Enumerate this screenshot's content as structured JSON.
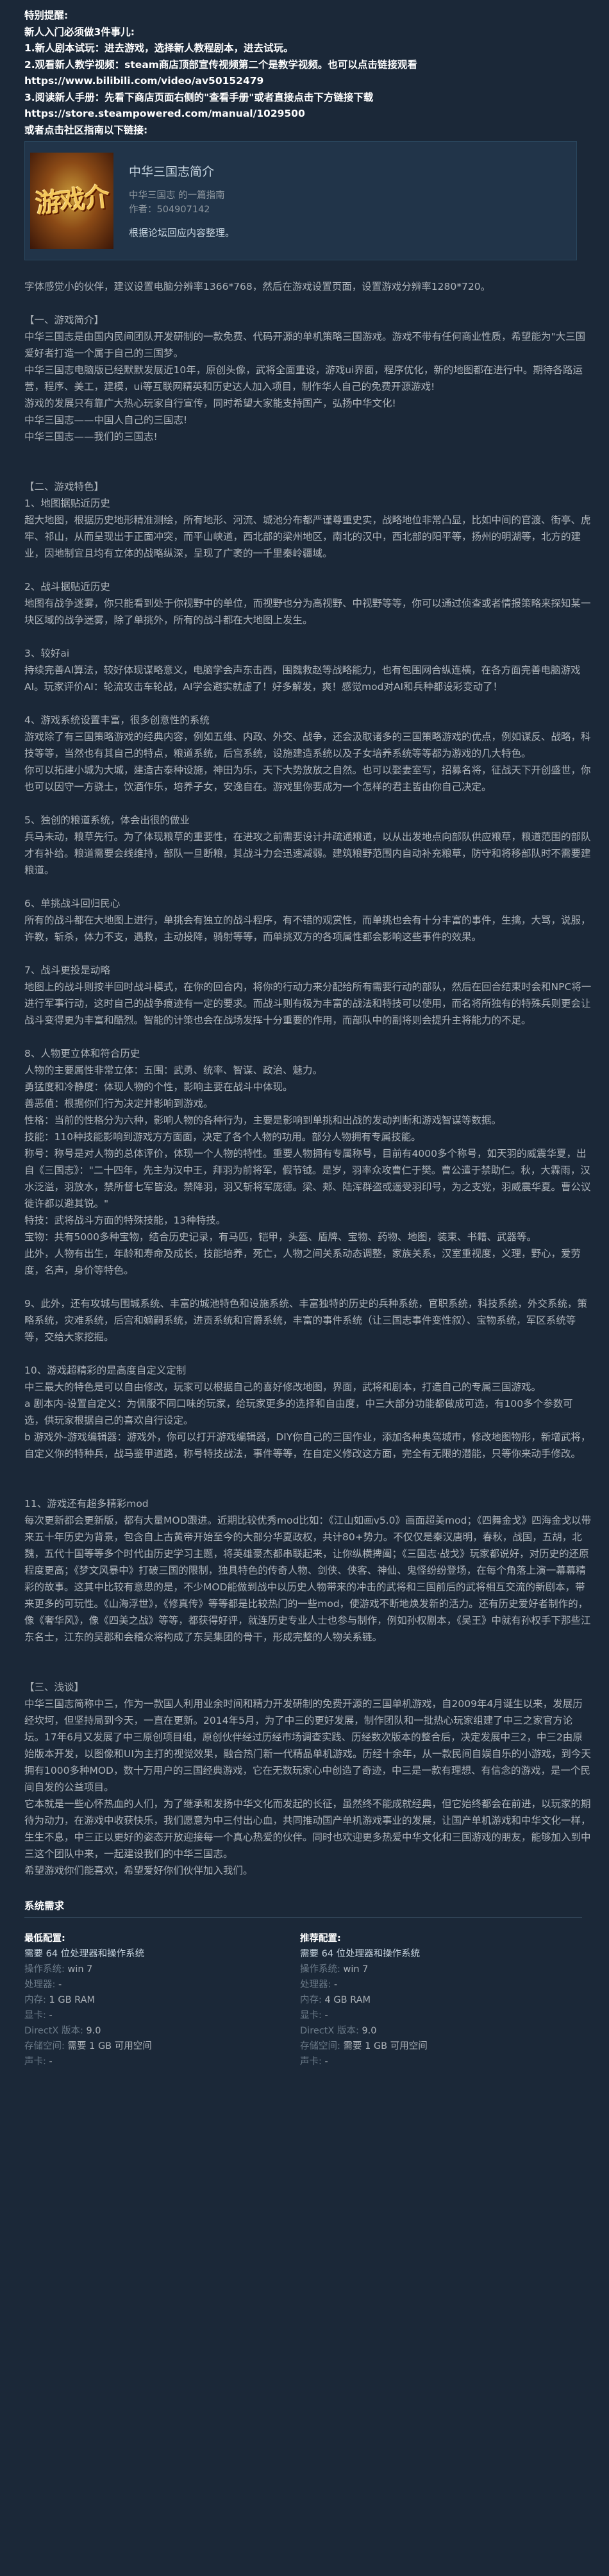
{
  "notice": {
    "lines": [
      "特别提醒:",
      "新人入门必须做3件事儿:",
      "1.新人剧本试玩：进去游戏，选择新人教程剧本，进去试玩。",
      "2.观看新人教学视频：steam商店顶部宣传视频第二个是教学视频。也可以点击链接观看",
      "https://www.bilibili.com/video/av50152479",
      "3.阅读新人手册：先看下商店页面右侧的\"查看手册\"或者直接点击下方链接下载",
      "https://store.steampowered.com/manual/1029500",
      "或者点击社区指南以下链接:"
    ]
  },
  "guide": {
    "logo_text": "游戏介",
    "title": "中华三国志简介",
    "subtitle": "中华三国志 的一篇指南",
    "author": "作者：504907142",
    "description": "根据论坛回应内容整理。"
  },
  "description": {
    "paragraphs": [
      "字体感觉小的伙伴，建议设置电脑分辨率1366*768，然后在游戏设置页面，设置游戏分辨率1280*720。",
      "",
      "【一、游戏简介】",
      "中华三国志是由国内民间团队开发研制的一款免费、代码开源的单机策略三国游戏。游戏不带有任何商业性质，希望能为\"大三国爱好者打造一个属于自己的三国梦。",
      "中华三国志电脑版已经默默发展近10年，原创头像，武将全面重设，游戏ui界面，程序优化，新的地图都在进行中。期待各路运营，程序、美工，建模，ui等互联网精英和历史达人加入项目，制作华人自己的免费开源游戏!",
      "游戏的发展只有靠广大热心玩家自行宣传，同时希望大家能支持国产，弘扬中华文化!",
      "中华三国志——中国人自己的三国志!",
      "中华三国志——我们的三国志!",
      "",
      "",
      "【二、游戏特色】",
      "1、地图据贴近历史",
      "超大地图，根据历史地形精准测绘，所有地形、河流、城池分布都严谨尊重史实，战略地位非常凸显，比如中间的官渡、街亭、虎牢、祁山，从而呈现出于正面冲突，而平山峡道，西北部的梁州地区，南北的汉中，西北部的阳平等，扬州的明湖等，北方的建业，因地制宜且均有立体的战略纵深，呈现了广袤的一千里秦岭疆域。",
      "",
      "2、战斗据贴近历史",
      "地图有战争迷雾，你只能看到处于你视野中的单位，而视野也分为高视野、中视野等等，你可以通过侦查或者情报策略来探知某一块区域的战争迷雾，除了单挑外，所有的战斗都在大地图上发生。",
      "",
      "3、较好ai",
      "持续完善AI算法，较好体现谋略意义，电脑学会声东击西，围魏救赵等战略能力，也有包围网合纵连横，在各方面完善电脑游戏AI。玩家评价AI：轮流攻击车轮战，AI学会避实就虚了！好多解发，爽！感觉mod对AI和兵种都设彩变动了！",
      "",
      "4、游戏系统设置丰富，很多创意性的系统",
      "游戏除了有三国策略游戏的经典内容，例如五维、内政、外交、战争，还会汲取诸多的三国策略游戏的优点，例如谋反、战略，科技等等，当然也有其自己的特点，粮道系统，后宫系统，设施建造系统以及子女培养系统等等都为游戏的几大特色。",
      "你可以拓建小城为大城，建造古泰种设施，神田为乐，天下大势放放之自然。也可以娶妻室写，招募名将，征战天下开创盛世，你也可以因守一方骁士，饮酒作乐，培养子女，安逸自在。游戏里你要成为一个怎样的君主皆由你自己决定。",
      "",
      "5、独创的粮道系统，体会出很的做业",
      "兵马未动，粮草先行。为了体现粮草的重要性，在进攻之前需要设计并疏通粮道，以从出发地点向部队供应粮草，粮道范围的部队才有补给。粮道需要会线维持，部队一旦断粮，其战斗力会迅速减弱。建筑粮野范围内自动补充粮草，防守和将移部队时不需要建粮道。",
      "",
      "6、单挑战斗回归民心",
      "所有的战斗都在大地图上进行，单挑会有独立的战斗程序，有不错的观赏性，而单挑也会有十分丰富的事件，生擒，大骂，说服，许教，斩杀，体力不支，遇救，主动投降，骑射等等，而单挑双方的各项属性都会影响这些事件的效果。",
      "",
      "7、战斗更投是动略",
      "地图上的战斗则按半回时战斗模式，在你的回合内，将你的行动力来分配给所有需要行动的部队，然后在回合结束时会和NPC将一进行军事行动，这时自己的战争痕迹有一定的要求。而战斗则有极为丰富的战法和特技可以使用，而名将所独有的特殊兵则更会让战斗变得更为丰富和酷烈。智能的计策也会在战场发挥十分重要的作用，而部队中的副将则会提升主将能力的不足。",
      "",
      "8、人物更立体和符合历史",
      "人物的主要属性非常立体：五围：武勇、统率、智谋、政治、魅力。",
      "勇猛度和冷静度：体现人物的个性，影响主要在战斗中体现。",
      "善恶值：根据你们行为决定并影响到游戏。",
      "性格：当前的性格分为六种，影响人物的各种行为，主要是影响到单挑和出战的发动判断和游戏智谋等数据。",
      "技能：110种技能影响到游戏方方面面，决定了各个人物的功用。部分人物拥有专属技能。",
      "称号：称号是对人物的总体评价，体现一个人物的特性。重要人物拥有专属称号，目前有4000多个称号，如天羽的威震华夏，出自《三国志》：\"二十四年，先主为汉中王，拜羽为前将军，假节钺。是岁，羽率众攻曹仁于樊。曹公遣于禁助仁。秋，大霖雨，汉水泛溢，羽放水，禁所督七军皆没。禁降羽，羽又斩将军庞德。梁、郏、陆浑群盗或遥受羽印号，为之支党，羽威震华夏。曹公议徙许都以避其锐。\"",
      "特技：武将战斗方面的特殊技能，13种特技。",
      "宝物：共有5000多种宝物，结合历史记录，有马匹，铠甲，头盔、盾牌、宝物、药物、地图，装束、书籍、武器等。",
      "此外，人物有出生，年龄和寿命及成长，技能培养，死亡，人物之间关系动态调整，家族关系，汉室重视度，义理，野心，爱劳度，名声，身价等特色。",
      "",
      "9、此外，还有攻城与围城系统、丰富的城池特色和设施系统、丰富独特的历史的兵种系统，官职系统，科技系统，外交系统，策略系统，灾难系统，后宫和嫡嗣系统，进贡系统和官爵系统，丰富的事件系统（让三国志事件变性叙）、宝物系统，军区系统等等，交给大家挖掘。",
      "",
      "10、游戏超精彩的是高度自定义定制",
      "中三最大的特色是可以自由修改，玩家可以根据自己的喜好修改地图，界面，武将和剧本，打造自己的专属三国游戏。",
      "a 剧本内-设置自定义：为佩服不同口味的玩家，给玩家更多的选择和自由度，中三大部分功能都做成可选，有100多个参数可选，供玩家根据自己的喜欢自行设定。",
      "b 游戏外-游戏编辑器：游戏外，你可以打开游戏编辑器，DIY你自己的三国作业，添加各种奥驾城市，修改地图物形，新增武将，自定义你的特种兵，战马鉴甲道路，称号特技战法，事件等等，在自定义修改这方面，完全有无限的潜能，只等你来动手修改。",
      "",
      "",
      "11、游戏还有超多精彩mod",
      "每次更新都会更新版，都有大量MOD跟进。近期比较优秀mod比如：《江山如画v5.0》画面超美mod；《四舞金戈》四海金戈以带来五十年历史为背景，包含自上古黄帝开始至今的大部分华夏政权，共计80+势力。不仅仅是秦汉唐明，春秋，战国，五胡，北魏，五代十国等等多个时代由历史学习主题，将英雄豪杰都串联起来，让你纵横捭阖；《三国志·战戈》玩家都说好，对历史的还原程度更高；《梦文风暴中》打破三国的限制，独具特色的传奇人物、剑侠、侠客、神仙、鬼怪纷纷登场，在每个角落上演一幕幕精彩的故事。这其中比较有意思的是，不少MOD能做到战中以历史人物带来的冲击的武将和三国前后的武将相互交流的新剧本，带来更多的可玩性。《山海浮世》，《修真传》等等都是比较热门的一些mod，使游戏不断地焕发新的活力。还有历史爱好者制作的，像《奢华风》，像《四美之战》等等，都获得好评，就连历史专业人士也参与制作，例如孙权剧本，《吴王》中就有孙权手下那些江东名士，江东的吴郡和会稽众将构成了东吴集团的骨干，形成完整的人物关系链。",
      "",
      "",
      "【三、浅谈】",
      "中华三国志简称中三，作为一款国人利用业余时间和精力开发研制的免费开源的三国单机游戏，自2009年4月诞生以来，发展历经坎坷，但坚持局到今天，一直在更新。2014年5月，为了中三的更好发展，制作团队和一批热心玩家组建了中三之家官方论坛。17年6月又发展了中三原创项目组，原创伙伴经过历经市场调查实践、历经数次版本的整合后，决定发展中三2，中三2由原始版本开发，以图像和UI为主打的视觉效果，融合热门新一代精品单机游戏。历经十余年，从一款民间自娱自乐的小游戏，到今天拥有1000多种MOD，数十万用户的三国经典游戏，它在无数玩家心中创造了奇迹，中三是一款有理想、有信念的游戏，是一个民间自发的公益项目。",
      "它本就是一些心怀热血的人们，为了继承和发扬中华文化而发起的长征，虽然终不能成就经典，但它始终都会在前进，以玩家的期待为动力，在游戏中收获快乐，我们愿意为中三付出心血，共同推动国产单机游戏事业的发展，让国产单机游戏和中华文化一样，生生不息，中三正以更好的姿态开放迎接每一个真心热爱的伙伴。同时也欢迎更多热爱中华文化和三国游戏的朋友，能够加入到中三这个团队中来，一起建设我们的中华三国志。",
      "希望游戏你们能喜欢，希望爱好你们伙伴加入我们。"
    ]
  },
  "sysreq": {
    "title": "系统需求",
    "minimum": {
      "head": "最低配置:",
      "rows": [
        {
          "k": "",
          "v": "需要 64 位处理器和操作系统",
          "bold": true
        },
        {
          "k": "操作系统:",
          "v": "win 7"
        },
        {
          "k": "处理器:",
          "v": "-"
        },
        {
          "k": "内存:",
          "v": "1 GB RAM"
        },
        {
          "k": "显卡:",
          "v": "-"
        },
        {
          "k": "DirectX 版本:",
          "v": "9.0"
        },
        {
          "k": "存储空间:",
          "v": "需要 1 GB 可用空间"
        },
        {
          "k": "声卡:",
          "v": "-"
        }
      ]
    },
    "recommended": {
      "head": "推荐配置:",
      "rows": [
        {
          "k": "",
          "v": "需要 64 位处理器和操作系统",
          "bold": true
        },
        {
          "k": "操作系统:",
          "v": "win 7"
        },
        {
          "k": "处理器:",
          "v": "-"
        },
        {
          "k": "内存:",
          "v": "4 GB RAM"
        },
        {
          "k": "显卡:",
          "v": "-"
        },
        {
          "k": "DirectX 版本:",
          "v": "9.0"
        },
        {
          "k": "存储空间:",
          "v": "需要 1 GB 可用空间"
        },
        {
          "k": "声卡:",
          "v": "-"
        }
      ]
    }
  }
}
